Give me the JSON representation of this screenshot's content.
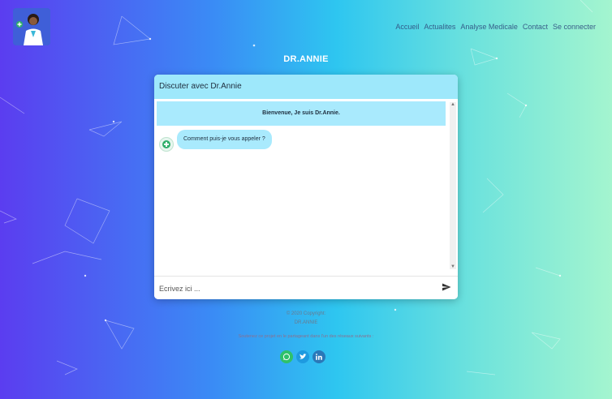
{
  "nav": {
    "items": [
      "Accueil",
      "Actualites",
      "Analyse Medicale",
      "Contact",
      "Se connecter"
    ]
  },
  "brand": "DR.ANNIE",
  "chat": {
    "header": "Discuter avec Dr.Annie",
    "welcome": "Bienvenue, Je suis Dr.Annie.",
    "bot_message": "Comment puis-je vous appeler ?",
    "input_placeholder": "Ecrivez ici ..."
  },
  "footer": {
    "copyright": "© 2020 Copyright:",
    "name": "DR.ANNIE",
    "share": "Soutenez ce projet en le partageant dans l'un des réseaux suivants :"
  },
  "icons": [
    "logo-doctor-icon",
    "send-icon",
    "whatsapp-icon",
    "twitter-icon",
    "linkedin-icon",
    "bot-avatar-icon"
  ]
}
